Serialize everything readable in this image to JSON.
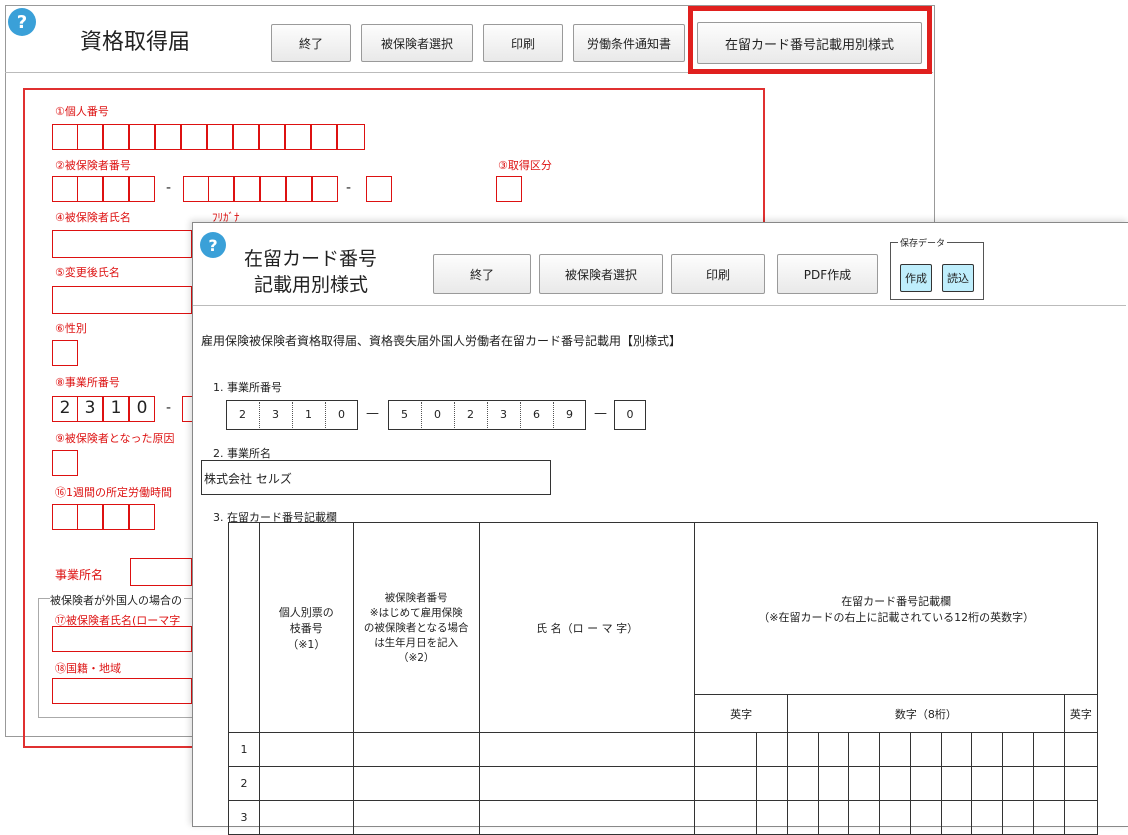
{
  "back": {
    "title": "資格取得届",
    "buttons": [
      "終了",
      "被保険者選択",
      "印刷",
      "労働条件通知書",
      "在留カード番号記載用別様式"
    ],
    "labels": {
      "personal_number": "①個人番号",
      "insured_number": "②被保険者番号",
      "acquisition_class": "③取得区分",
      "insured_name": "④被保険者氏名",
      "furigana": "ﾌﾘｶﾞﾅ",
      "changed_name": "⑤変更後氏名",
      "sex": "⑥性別",
      "office_number": "⑧事業所番号",
      "cause": "⑨被保険者となった原因",
      "weekly_hours": "⑯1週間の所定労働時間",
      "office_name": "事業所名",
      "foreigner_group": "被保険者が外国人の場合の",
      "roman_name": "⑰被保険者氏名(ローマ字",
      "nationality": "⑱国籍・地域"
    },
    "office_digits": [
      "2",
      "3",
      "1",
      "0"
    ],
    "dash": "-"
  },
  "front": {
    "title_line1": "在留カード番号",
    "title_line2": "記載用別様式",
    "buttons": [
      "終了",
      "被保険者選択",
      "印刷",
      "PDF作成"
    ],
    "save_group": "保存データ",
    "save_buttons": [
      "作成",
      "読込"
    ],
    "heading": "雇用保険被保険者資格取得届、資格喪失届外国人労働者在留カード番号記載用【別様式】",
    "section1": "1. 事業所番号",
    "office_digits_a": [
      "2",
      "3",
      "1",
      "0"
    ],
    "office_digits_b": [
      "5",
      "0",
      "2",
      "3",
      "6",
      "9"
    ],
    "office_digits_c": [
      "0"
    ],
    "dash": "—",
    "section2": "2. 事業所名",
    "office_name": "株式会社 セルズ",
    "section3": "3. 在留カード番号記載欄",
    "table": {
      "col_branch": [
        "個人別票の",
        "枝番号",
        "（※1）"
      ],
      "col_insured": [
        "被保険者番号",
        "※はじめて雇用保険",
        "の被保険者となる場合",
        "は生年月日を記入",
        "（※2）"
      ],
      "col_name": "氏 名（ロ ー マ 字）",
      "col_card": [
        "在留カード番号記載欄",
        "（※在留カードの右上に記載されている12桁の英数字）"
      ],
      "sub_alpha1": "英字",
      "sub_digits": "数字（8桁）",
      "sub_alpha2": "英字",
      "rows": [
        "1",
        "2",
        "3"
      ]
    }
  }
}
